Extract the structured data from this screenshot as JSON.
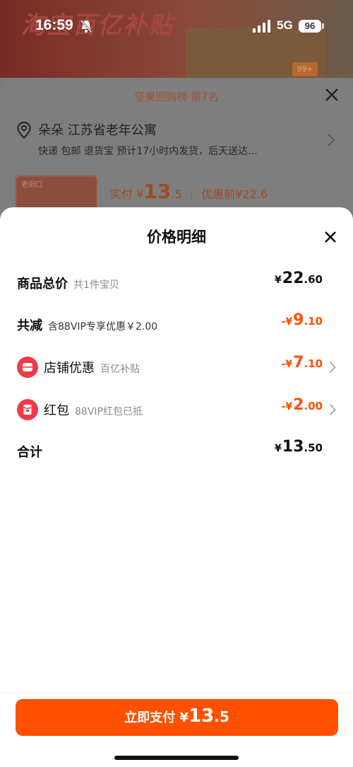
{
  "status_bar": {
    "time": "16:59",
    "network": "5G",
    "battery": "96",
    "icons": [
      "bell-slash-icon",
      "signal-icon"
    ]
  },
  "background_page": {
    "banner_text": "淘宝百亿补贴",
    "badge": "99+"
  },
  "order_sheet": {
    "ranking": "坚果回购榜·第7名",
    "recipient": "朵朵 江苏省老年公寓",
    "delivery": "快递 包邮 退货宝 预计17小时内发货，后天送达...",
    "paid_label": "实付",
    "paid_currency": "¥",
    "paid_int": "13",
    "paid_dec": ".5",
    "before_label": "优惠前",
    "before_value": "¥22.6",
    "thumb_text": "老街口"
  },
  "price_detail": {
    "title": "价格明细",
    "rows": {
      "total": {
        "label": "商品总价",
        "sub": "共1件宝贝",
        "currency": "¥",
        "int": "22",
        "dec": ".60"
      },
      "reduce": {
        "label": "共减",
        "sub": "含88VIP专享优惠￥2.00",
        "currency": "-¥",
        "int": "9",
        "dec": ".10"
      },
      "store": {
        "label": "店铺优惠",
        "sub": "百亿补贴",
        "currency": "-¥",
        "int": "7",
        "dec": ".10",
        "icon": "store-coupon-icon"
      },
      "redpacket": {
        "label": "红包",
        "sub": "88VIP红包已抵",
        "currency": "-¥",
        "int": "2",
        "dec": ".00",
        "icon": "red-packet-icon"
      },
      "sum": {
        "label": "合计",
        "currency": "¥",
        "int": "13",
        "dec": ".50"
      }
    },
    "pay_button": {
      "label": "立即支付",
      "currency": "¥",
      "int": "13",
      "dec": ".5"
    }
  },
  "colors": {
    "accent": "#ff5000",
    "icon_red": "#f23a45"
  }
}
